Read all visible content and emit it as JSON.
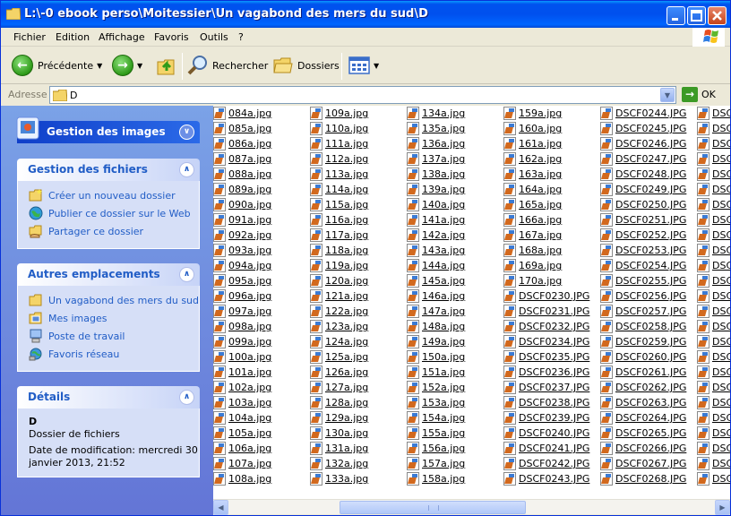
{
  "window": {
    "title": "L:\\-0 ebook perso\\Moitessier\\Un vagabond des mers du sud\\D"
  },
  "menu": [
    "Fichier",
    "Edition",
    "Affichage",
    "Favoris",
    "Outils",
    "?"
  ],
  "toolbar": {
    "back_label": "Précédente",
    "search_label": "Rechercher",
    "folders_label": "Dossiers"
  },
  "address": {
    "label": "Adresse",
    "value": "D",
    "go_label": "OK"
  },
  "sidebar": {
    "special": {
      "title": "Gestion des images"
    },
    "file_tasks": {
      "title": "Gestion des fichiers",
      "items": [
        "Créer un nouveau dossier",
        "Publier ce dossier sur le Web",
        "Partager ce dossier"
      ]
    },
    "other_places": {
      "title": "Autres emplacements",
      "items": [
        "Un vagabond des mers du sud",
        "Mes images",
        "Poste de travail",
        "Favoris réseau"
      ]
    },
    "details": {
      "title": "Détails",
      "name": "D",
      "type": "Dossier de fichiers",
      "modified_line1": "Date de modification: mercredi 30",
      "modified_line2": "janvier 2013, 21:52"
    }
  },
  "files": {
    "columns": [
      [
        "084a.jpg",
        "085a.jpg",
        "086a.jpg",
        "087a.jpg",
        "088a.jpg",
        "089a.jpg",
        "090a.jpg",
        "091a.jpg",
        "092a.jpg",
        "093a.jpg",
        "094a.jpg",
        "095a.jpg",
        "096a.jpg",
        "097a.jpg",
        "098a.jpg",
        "099a.jpg",
        "100a.jpg",
        "101a.jpg",
        "102a.jpg",
        "103a.jpg",
        "104a.jpg",
        "105a.jpg",
        "106a.jpg",
        "107a.jpg",
        "108a.jpg"
      ],
      [
        "109a.jpg",
        "110a.jpg",
        "111a.jpg",
        "112a.jpg",
        "113a.jpg",
        "114a.jpg",
        "115a.jpg",
        "116a.jpg",
        "117a.jpg",
        "118a.jpg",
        "119a.jpg",
        "120a.jpg",
        "121a.jpg",
        "122a.jpg",
        "123a.jpg",
        "124a.jpg",
        "125a.jpg",
        "126a.jpg",
        "127a.jpg",
        "128a.jpg",
        "129a.jpg",
        "130a.jpg",
        "131a.jpg",
        "132a.jpg",
        "133a.jpg"
      ],
      [
        "134a.jpg",
        "135a.jpg",
        "136a.jpg",
        "137a.jpg",
        "138a.jpg",
        "139a.jpg",
        "140a.jpg",
        "141a.jpg",
        "142a.jpg",
        "143a.jpg",
        "144a.jpg",
        "145a.jpg",
        "146a.jpg",
        "147a.jpg",
        "148a.jpg",
        "149a.jpg",
        "150a.jpg",
        "151a.jpg",
        "152a.jpg",
        "153a.jpg",
        "154a.jpg",
        "155a.jpg",
        "156a.jpg",
        "157a.jpg",
        "158a.jpg"
      ],
      [
        "159a.jpg",
        "160a.jpg",
        "161a.jpg",
        "162a.jpg",
        "163a.jpg",
        "164a.jpg",
        "165a.jpg",
        "166a.jpg",
        "167a.jpg",
        "168a.jpg",
        "169a.jpg",
        "170a.jpg",
        "DSCF0230.JPG",
        "DSCF0231.JPG",
        "DSCF0232.JPG",
        "DSCF0234.JPG",
        "DSCF0235.JPG",
        "DSCF0236.JPG",
        "DSCF0237.JPG",
        "DSCF0238.JPG",
        "DSCF0239.JPG",
        "DSCF0240.JPG",
        "DSCF0241.JPG",
        "DSCF0242.JPG",
        "DSCF0243.JPG"
      ],
      [
        "DSCF0244.JPG",
        "DSCF0245.JPG",
        "DSCF0246.JPG",
        "DSCF0247.JPG",
        "DSCF0248.JPG",
        "DSCF0249.JPG",
        "DSCF0250.JPG",
        "DSCF0251.JPG",
        "DSCF0252.JPG",
        "DSCF0253.JPG",
        "DSCF0254.JPG",
        "DSCF0255.JPG",
        "DSCF0256.JPG",
        "DSCF0257.JPG",
        "DSCF0258.JPG",
        "DSCF0259.JPG",
        "DSCF0260.JPG",
        "DSCF0261.JPG",
        "DSCF0262.JPG",
        "DSCF0263.JPG",
        "DSCF0264.JPG",
        "DSCF0265.JPG",
        "DSCF0266.JPG",
        "DSCF0267.JPG",
        "DSCF0268.JPG"
      ],
      [
        "DSC",
        "DSC",
        "DSC",
        "DSC",
        "DSC",
        "DSC",
        "DSC",
        "DSC",
        "DSC",
        "DSC",
        "DSC",
        "DSC",
        "DSC",
        "DSC",
        "DSC",
        "DSC",
        "DSC",
        "DSC",
        "DSC",
        "DSC",
        "DSC",
        "DSC",
        "DSC",
        "DSC",
        "DSC"
      ]
    ]
  },
  "icons": {
    "thumb": "jpeg-file-icon"
  }
}
